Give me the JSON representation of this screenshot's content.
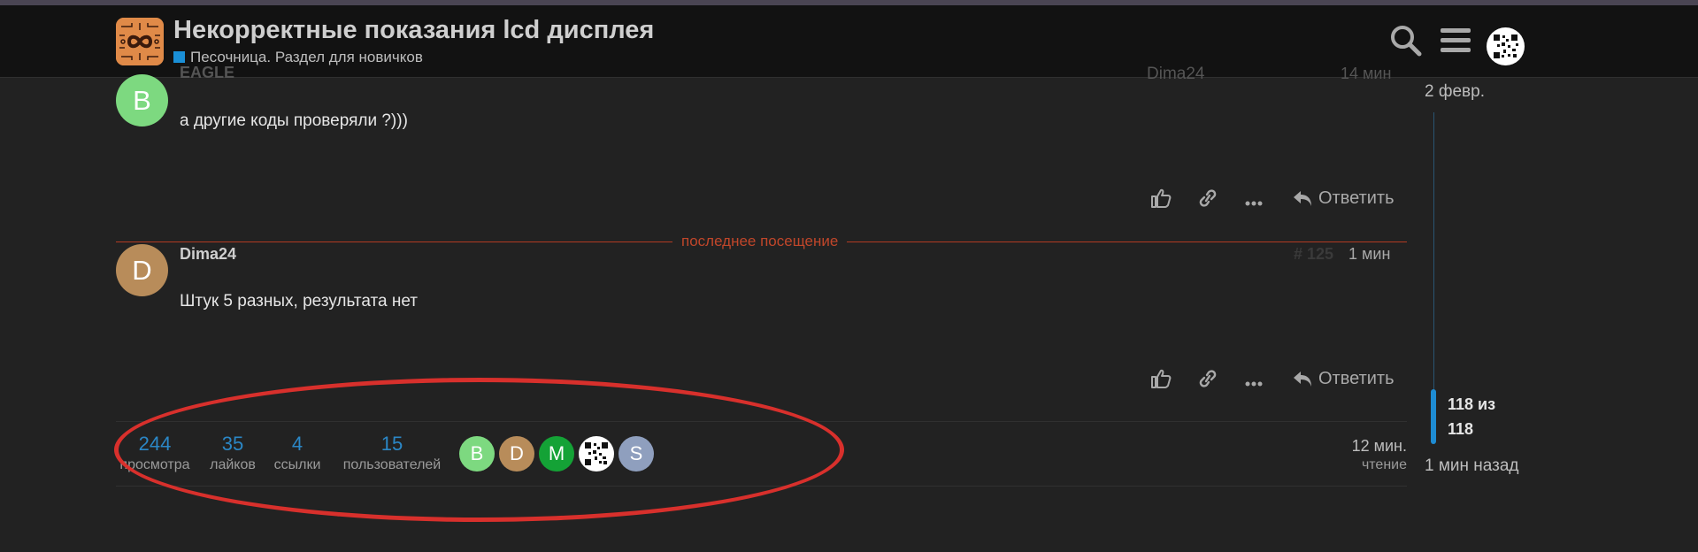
{
  "header": {
    "title": "Некорректные показания lcd дисплея",
    "category": "Песочница. Раздел для новичков",
    "category_color": "#1a8fd6",
    "icons": [
      "search-icon",
      "hamburger-menu-icon",
      "user-avatar"
    ]
  },
  "posts": [
    {
      "author_initial": "B",
      "author_name": "EAGLE",
      "avatar_color": "#7dd980",
      "reply_to_name": "Dima24",
      "time": "14 мин",
      "text": "а другие коды проверяли ?)))"
    },
    {
      "author_initial": "D",
      "author_name": "Dima24",
      "avatar_color": "#b88c5a",
      "number": "# 125",
      "time": "1 мин",
      "text": "Штук 5 разных, результата нет"
    }
  ],
  "actions": {
    "reply_label": "Ответить",
    "icons": [
      "like-icon",
      "link-icon",
      "more-icon",
      "reply-icon"
    ]
  },
  "last_visit_label": "последнее посещение",
  "stats": {
    "views": {
      "value": "244",
      "label": "просмотра"
    },
    "likes": {
      "value": "35",
      "label": "лайков"
    },
    "links": {
      "value": "4",
      "label": "ссылки"
    },
    "users": {
      "value": "15",
      "label": "пользователей"
    },
    "participants": [
      {
        "initial": "B",
        "color": "#7dd980"
      },
      {
        "initial": "D",
        "color": "#b88c5a"
      },
      {
        "initial": "M",
        "color": "#14a236"
      },
      {
        "initial": "",
        "color": "#ffffff"
      },
      {
        "initial": "S",
        "color": "#8f9fbe"
      }
    ],
    "read_time": "12 мин.",
    "read_label": "чтение"
  },
  "timeline": {
    "start_date": "2 февр.",
    "position_line1": "118 из",
    "position_line2": "118",
    "last_activity": "1 мин назад",
    "progress": 1.0,
    "accent_color": "#1e8cd3"
  },
  "annotation": {
    "shape": "ellipse",
    "color": "#d8302c"
  }
}
